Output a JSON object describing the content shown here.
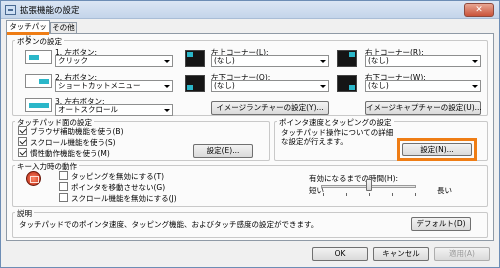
{
  "window": {
    "title": "拡張機能の設定",
    "close_label": "✕"
  },
  "tabs": [
    {
      "label": "タッチパッド"
    },
    {
      "label": "その他"
    }
  ],
  "button_settings": {
    "title": "ボタンの設定",
    "buttons": [
      {
        "label": "1. 左ボタン:",
        "value": "クリック"
      },
      {
        "label": "2. 右ボタン:",
        "value": "ショートカットメニュー"
      },
      {
        "label": "3. 左右ボタン:",
        "value": "オートスクロール"
      }
    ],
    "corners": [
      {
        "label": "左上コーナー(L):",
        "value": "(なし)"
      },
      {
        "label": "右上コーナー(R):",
        "value": "(なし)"
      },
      {
        "label": "左下コーナー(O):",
        "value": "(なし)"
      },
      {
        "label": "右下コーナー(W):",
        "value": "(なし)"
      }
    ],
    "image_launcher_button": "イメージランチャーの設定(Y)...",
    "image_capture_button": "イメージキャプチャーの設定(U)..."
  },
  "touchpad_settings": {
    "title": "タッチパッド面の設定",
    "options": [
      {
        "label": "ブラウザ補助機能を使う(B)",
        "checked": true
      },
      {
        "label": "スクロール機能を使う(S)",
        "checked": true
      },
      {
        "label": "慣性動作機能を使う(M)",
        "checked": true
      }
    ],
    "settings_button": "設定(E)..."
  },
  "pointer_settings": {
    "title": "ポインタ速度とタッピングの設定",
    "description": "タッチパッド操作についての詳細な設定が行えます。",
    "settings_button": "設定(N)..."
  },
  "key_input": {
    "title": "キー入力時の動作",
    "options": [
      {
        "label": "タッピングを無効にする(T)",
        "checked": false
      },
      {
        "label": "ポインタを移動させない(G)",
        "checked": false
      },
      {
        "label": "スクロール機能を無効にする(J)",
        "checked": false
      }
    ],
    "timeout_label": "有効になるまでの時間(H):",
    "slider_min_label": "短い",
    "slider_max_label": "長い",
    "slider_position": 0.5
  },
  "description": {
    "title": "説明",
    "text": "タッチパッドでのポインタ速度、タッピング機能、およびタッチ感度の設定ができます。",
    "default_button": "デフォルト(D)"
  },
  "footer": {
    "ok": "OK",
    "cancel": "キャンセル",
    "apply": "適用(A)"
  },
  "colors": {
    "highlight": "#ef7d15",
    "touchpad_accent": "#2bb7c9"
  }
}
